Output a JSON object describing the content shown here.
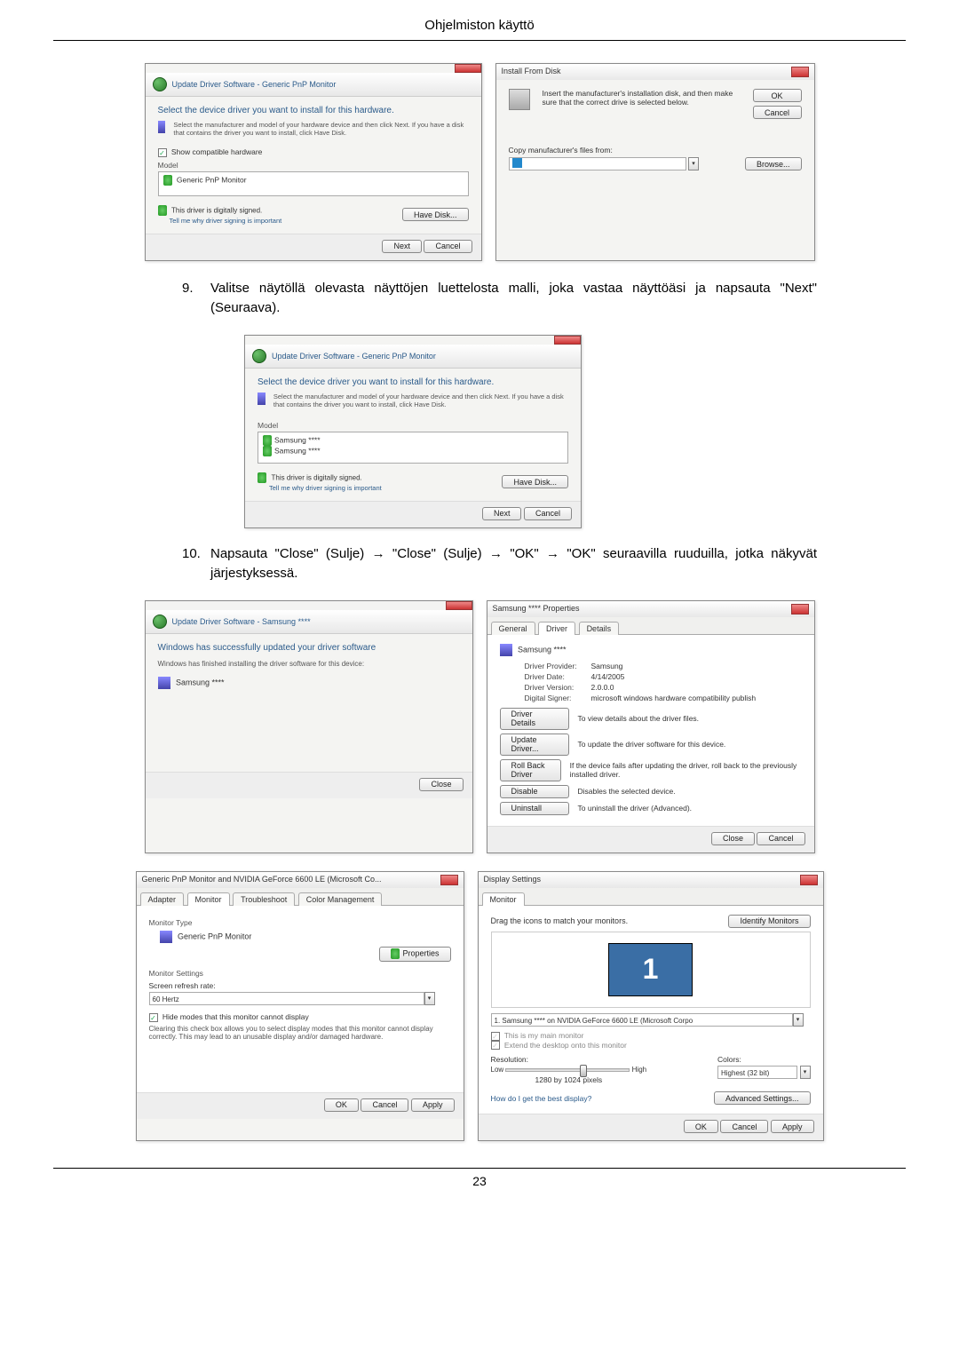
{
  "header": {
    "title": "Ohjelmiston käyttö"
  },
  "step9": {
    "num": "9.",
    "text": "Valitse näytöllä olevasta näyttöjen luettelosta malli, joka vastaa näyttöäsi ja napsauta \"Next\" (Seuraava)."
  },
  "step10": {
    "num": "10.",
    "text": "Napsauta \"Close\" (Sulje) → \"Close\" (Sulje) → \"OK\" → \"OK\" seuraavilla ruuduilla, jotka näkyvät järjestyksessä."
  },
  "dlg1": {
    "nav": "Update Driver Software - Generic PnP Monitor",
    "heading": "Select the device driver you want to install for this hardware.",
    "sub": "Select the manufacturer and model of your hardware device and then click Next. If you have a disk that contains the driver you want to install, click Have Disk.",
    "compat": "Show compatible hardware",
    "model_label": "Model",
    "model_item": "Generic PnP Monitor",
    "signed": "This driver is digitally signed.",
    "tell": "Tell me why driver signing is important",
    "have_disk": "Have Disk...",
    "next": "Next",
    "cancel": "Cancel"
  },
  "dlg2": {
    "title": "Install From Disk",
    "msg": "Insert the manufacturer's installation disk, and then make sure that the correct drive is selected below.",
    "ok": "OK",
    "cancel": "Cancel",
    "copy_label": "Copy manufacturer's files from:",
    "browse": "Browse..."
  },
  "dlg3": {
    "nav": "Update Driver Software - Generic PnP Monitor",
    "heading": "Select the device driver you want to install for this hardware.",
    "sub": "Select the manufacturer and model of your hardware device and then click Next. If you have a disk that contains the driver you want to install, click Have Disk.",
    "model_label": "Model",
    "item1": "Samsung ****",
    "item2": "Samsung ****",
    "signed": "This driver is digitally signed.",
    "tell": "Tell me why driver signing is important",
    "have_disk": "Have Disk...",
    "next": "Next",
    "cancel": "Cancel"
  },
  "dlg4": {
    "nav": "Update Driver Software - Samsung ****",
    "heading": "Windows has successfully updated your driver software",
    "sub": "Windows has finished installing the driver software for this device:",
    "device": "Samsung ****",
    "close": "Close"
  },
  "dlg5": {
    "title": "Samsung **** Properties",
    "tabs": [
      "General",
      "Driver",
      "Details"
    ],
    "device": "Samsung ****",
    "rows": {
      "provider_l": "Driver Provider:",
      "provider_v": "Samsung",
      "date_l": "Driver Date:",
      "date_v": "4/14/2005",
      "ver_l": "Driver Version:",
      "ver_v": "2.0.0.0",
      "sign_l": "Digital Signer:",
      "sign_v": "microsoft windows hardware compatibility publish"
    },
    "btns": {
      "details": "Driver Details",
      "details_t": "To view details about the driver files.",
      "update": "Update Driver...",
      "update_t": "To update the driver software for this device.",
      "roll": "Roll Back Driver",
      "roll_t": "If the device fails after updating the driver, roll back to the previously installed driver.",
      "disable": "Disable",
      "disable_t": "Disables the selected device.",
      "uninstall": "Uninstall",
      "uninstall_t": "To uninstall the driver (Advanced)."
    },
    "close": "Close",
    "cancel": "Cancel"
  },
  "dlg6": {
    "title": "Generic PnP Monitor and NVIDIA GeForce 6600 LE (Microsoft Co...",
    "tabs": [
      "Adapter",
      "Monitor",
      "Troubleshoot",
      "Color Management"
    ],
    "mtype": "Monitor Type",
    "mname": "Generic PnP Monitor",
    "props": "Properties",
    "msettings": "Monitor Settings",
    "refresh_l": "Screen refresh rate:",
    "refresh_v": "60 Hertz",
    "hide": "Hide modes that this monitor cannot display",
    "hide_t": "Clearing this check box allows you to select display modes that this monitor cannot display correctly. This may lead to an unusable display and/or damaged hardware.",
    "ok": "OK",
    "cancel": "Cancel",
    "apply": "Apply"
  },
  "dlg7": {
    "title": "Display Settings",
    "tab": "Monitor",
    "drag": "Drag the icons to match your monitors.",
    "identify": "Identify Monitors",
    "num": "1",
    "combo": "1. Samsung **** on NVIDIA GeForce 6600 LE (Microsoft Corpo",
    "main": "This is my main monitor",
    "extend": "Extend the desktop onto this monitor",
    "res_l": "Resolution:",
    "col_l": "Colors:",
    "low": "Low",
    "high": "High",
    "res_v": "1280 by 1024 pixels",
    "col_v": "Highest (32 bit)",
    "best": "How do I get the best display?",
    "adv": "Advanced Settings...",
    "ok": "OK",
    "cancel": "Cancel",
    "apply": "Apply"
  },
  "footer": {
    "page": "23"
  }
}
